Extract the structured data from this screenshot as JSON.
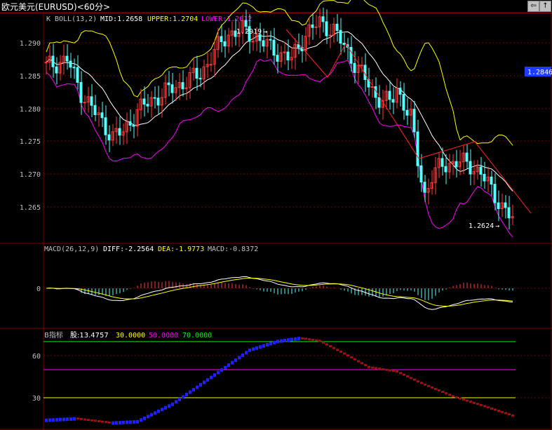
{
  "window": {
    "title": "欧元美元(EURUSD)<60分>",
    "nav_prev": "⇦",
    "nav_next": "⇨",
    "nav_up": "↑"
  },
  "colors": {
    "up": "#ff3b3b",
    "down": "#54ffff",
    "mid": "#ffffff",
    "upper": "#ffff00",
    "lower": "#ff00ff",
    "grid": "#800000",
    "trend": "#ff2020",
    "diff": "#ffffff",
    "dea": "#ffff00",
    "macd_pos": "#ff3b3b",
    "macd_neg": "#54ffff",
    "b_up": "#2020ff",
    "b_down": "#a01010",
    "lvl30": "#ffff00",
    "lvl50": "#ff00ff",
    "lvl70": "#00ff00"
  },
  "chart_data": [
    {
      "type": "candlestick",
      "legend": {
        "k": "K",
        "boll": "BOLL(13,2)",
        "mid": "MID:1.2658",
        "upper": "UPPER:1.2704",
        "lower": "LOWER:1.2612"
      },
      "yticks": [
        "1.290",
        "1.285",
        "1.280",
        "1.275",
        "1.270",
        "1.265"
      ],
      "ylim": [
        1.261,
        1.292
      ],
      "annotations": {
        "high": "1.2919",
        "low": "1.2624",
        "arrow": "→"
      },
      "current_price": "1.2846",
      "series_type": "ohlc"
    },
    {
      "type": "bar+line",
      "legend": {
        "name": "MACD(26,12,9)",
        "diff": "DIFF:-2.2564",
        "dea": "DEA:-1.9773",
        "macd": "MACD:-0.8372"
      },
      "yticks": [
        "0"
      ]
    },
    {
      "type": "line",
      "legend": {
        "name": "B指标",
        "value": "股:13.4757",
        "l30": "30.0000",
        "l50": "50.0000",
        "l70": "70.0000"
      },
      "yticks": [
        "60",
        "30"
      ],
      "ylim": [
        10,
        72
      ]
    }
  ]
}
